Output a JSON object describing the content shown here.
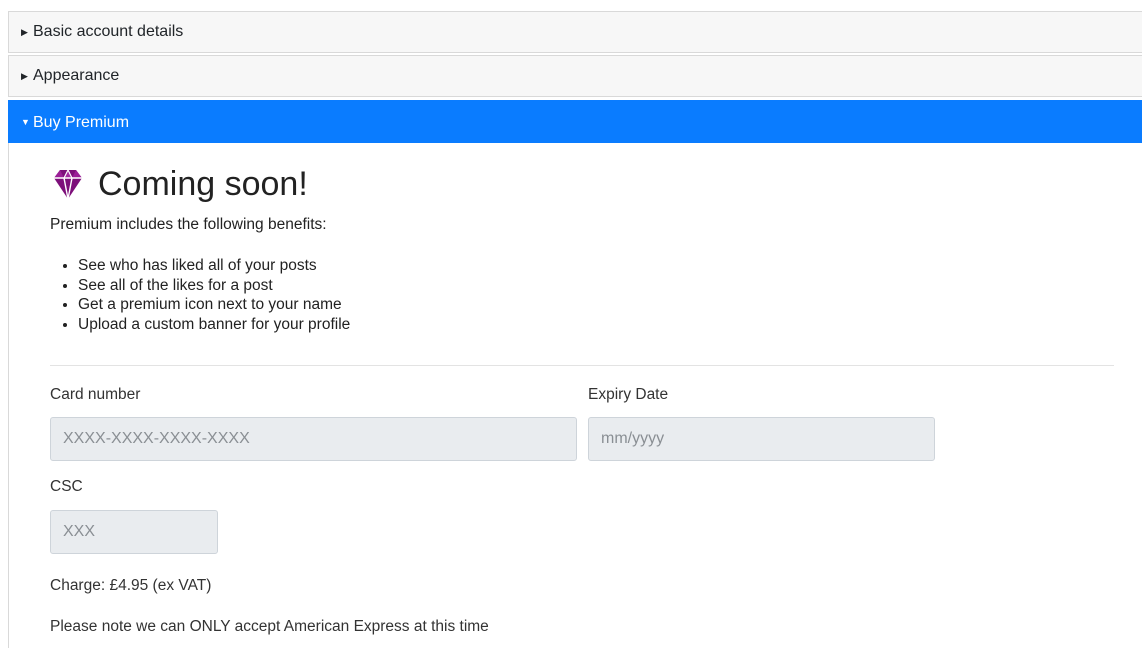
{
  "accordion": {
    "sections": [
      {
        "label": "Basic account details",
        "expanded": false
      },
      {
        "label": "Appearance",
        "expanded": false
      },
      {
        "label": "Buy Premium",
        "expanded": true
      }
    ],
    "active_color": "#0a7cff"
  },
  "premium": {
    "icon": "gem-icon",
    "icon_color": "#7d0f7a",
    "title": "Coming soon!",
    "intro": "Premium includes the following benefits:",
    "benefits": [
      "See who has liked all of your posts",
      "See all of the likes for a post",
      "Get a premium icon next to your name",
      "Upload a custom banner for your profile"
    ]
  },
  "form": {
    "card_number_label": "Card number",
    "card_number_placeholder": "XXXX-XXXX-XXXX-XXXX",
    "expiry_label": "Expiry Date",
    "expiry_placeholder": "mm/yyyy",
    "csc_label": "CSC",
    "csc_placeholder": "XXX"
  },
  "charge_text": "Charge: £4.95 (ex VAT)",
  "note_text": "Please note we can ONLY accept American Express at this time"
}
